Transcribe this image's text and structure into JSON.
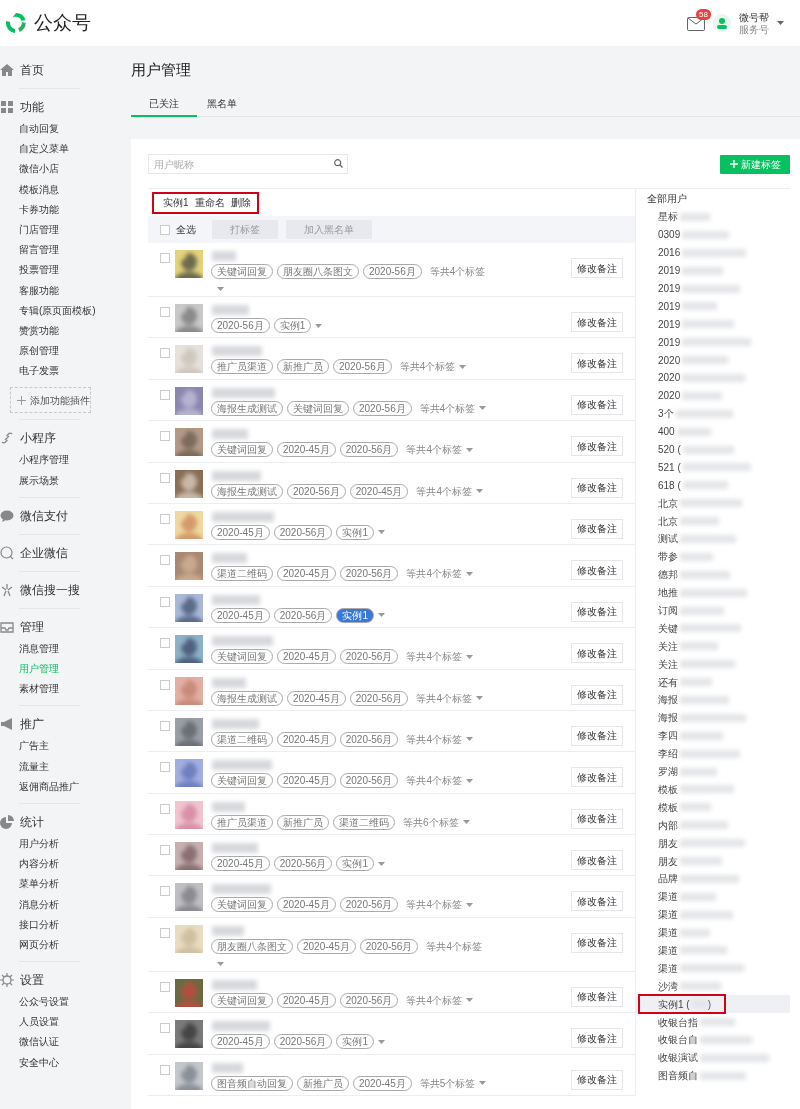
{
  "header": {
    "logo": "公众号",
    "mail_badge": "58",
    "account_name": "微号帮",
    "account_type": "服务号"
  },
  "sidebar": {
    "sections": [
      {
        "title": "首页"
      },
      {
        "title": "功能",
        "items": [
          {
            "label": "自动回复",
            "selected": false
          },
          {
            "label": "自定义菜单",
            "selected": false
          },
          {
            "label": "微信小店",
            "selected": false
          },
          {
            "label": "模板消息",
            "selected": false
          },
          {
            "label": "卡券功能",
            "selected": false
          },
          {
            "label": "门店管理",
            "selected": false
          },
          {
            "label": "留言管理",
            "selected": false
          },
          {
            "label": "投票管理",
            "selected": false
          },
          {
            "label": "客服功能",
            "selected": false
          },
          {
            "label": "专辑(原页面模板)",
            "selected": false
          },
          {
            "label": "赞赏功能",
            "selected": false
          },
          {
            "label": "原创管理",
            "selected": false
          },
          {
            "label": "电子发票",
            "selected": false
          }
        ],
        "add_button": "添加功能插件"
      },
      {
        "title": "小程序",
        "items": [
          {
            "label": "小程序管理",
            "selected": false
          },
          {
            "label": "展示场景",
            "selected": false
          }
        ]
      },
      {
        "title": "微信支付"
      },
      {
        "title": "企业微信"
      },
      {
        "title": "微信搜一搜"
      },
      {
        "title": "管理",
        "items": [
          {
            "label": "消息管理",
            "selected": false
          },
          {
            "label": "用户管理",
            "selected": true
          },
          {
            "label": "素材管理",
            "selected": false
          }
        ]
      },
      {
        "title": "推广",
        "items": [
          {
            "label": "广告主",
            "selected": false
          },
          {
            "label": "流量主",
            "selected": false
          },
          {
            "label": "返佣商品推广",
            "selected": false
          }
        ]
      },
      {
        "title": "统计",
        "items": [
          {
            "label": "用户分析",
            "selected": false
          },
          {
            "label": "内容分析",
            "selected": false
          },
          {
            "label": "菜单分析",
            "selected": false
          },
          {
            "label": "消息分析",
            "selected": false
          },
          {
            "label": "接口分析",
            "selected": false
          },
          {
            "label": "网页分析",
            "selected": false
          }
        ]
      },
      {
        "title": "设置",
        "items": [
          {
            "label": "公众号设置",
            "selected": false
          },
          {
            "label": "人员设置",
            "selected": false
          },
          {
            "label": "微信认证",
            "selected": false
          },
          {
            "label": "安全中心",
            "selected": false
          }
        ]
      }
    ]
  },
  "page_title": "用户管理",
  "tabs": [
    {
      "label": "已关注",
      "selected": true
    },
    {
      "label": "黑名单",
      "selected": false
    }
  ],
  "search": {
    "placeholder": "用户昵称"
  },
  "new_tag_button": "新建标签",
  "group_header": {
    "name": "实例1",
    "actions": [
      "重命名",
      "删除"
    ],
    "highlighted": true
  },
  "toolbar": {
    "select_all": {
      "label": "全选",
      "checked": false
    },
    "buttons": [
      {
        "label": "打标签",
        "disabled": true
      },
      {
        "label": "加入黑名单",
        "disabled": true
      }
    ]
  },
  "users": [
    {
      "checked": false,
      "tags": [
        {
          "label": "关键词回复",
          "selected": false
        },
        {
          "label": "朋友圈八条图文",
          "selected": false
        },
        {
          "label": "2020-56月",
          "selected": false
        }
      ],
      "more": "等共4个标签",
      "button": "修改备注"
    },
    {
      "checked": false,
      "tags": [
        {
          "label": "2020-56月",
          "selected": false
        },
        {
          "label": "实例1",
          "selected": false
        }
      ],
      "button": "修改备注"
    },
    {
      "checked": false,
      "tags": [
        {
          "label": "推广员渠道",
          "selected": false
        },
        {
          "label": "新推广员",
          "selected": false
        },
        {
          "label": "2020-56月",
          "selected": false
        }
      ],
      "more": "等共4个标签",
      "button": "修改备注"
    },
    {
      "checked": false,
      "tags": [
        {
          "label": "海报生成测试",
          "selected": false
        },
        {
          "label": "关键词回复",
          "selected": false
        },
        {
          "label": "2020-56月",
          "selected": false
        }
      ],
      "more": "等共4个标签",
      "button": "修改备注"
    },
    {
      "checked": false,
      "tags": [
        {
          "label": "关键词回复",
          "selected": false
        },
        {
          "label": "2020-45月",
          "selected": false
        },
        {
          "label": "2020-56月",
          "selected": false
        }
      ],
      "more": "等共4个标签",
      "button": "修改备注"
    },
    {
      "checked": false,
      "tags": [
        {
          "label": "海报生成测试",
          "selected": false
        },
        {
          "label": "2020-56月",
          "selected": false
        },
        {
          "label": "2020-45月",
          "selected": false
        }
      ],
      "more": "等共4个标签",
      "button": "修改备注"
    },
    {
      "checked": false,
      "tags": [
        {
          "label": "2020-45月",
          "selected": false
        },
        {
          "label": "2020-56月",
          "selected": false
        },
        {
          "label": "实例1",
          "selected": false
        }
      ],
      "button": "修改备注"
    },
    {
      "checked": false,
      "tags": [
        {
          "label": "渠道二维码",
          "selected": false
        },
        {
          "label": "2020-45月",
          "selected": false
        },
        {
          "label": "2020-56月",
          "selected": false
        }
      ],
      "more": "等共4个标签",
      "button": "修改备注"
    },
    {
      "checked": false,
      "tags": [
        {
          "label": "2020-45月",
          "selected": false
        },
        {
          "label": "2020-56月",
          "selected": false
        },
        {
          "label": "实例1",
          "selected": true
        }
      ],
      "button": "修改备注"
    },
    {
      "checked": false,
      "tags": [
        {
          "label": "关键词回复",
          "selected": false
        },
        {
          "label": "2020-45月",
          "selected": false
        },
        {
          "label": "2020-56月",
          "selected": false
        }
      ],
      "more": "等共4个标签",
      "button": "修改备注"
    },
    {
      "checked": false,
      "tags": [
        {
          "label": "海报生成测试",
          "selected": false
        },
        {
          "label": "2020-45月",
          "selected": false
        },
        {
          "label": "2020-56月",
          "selected": false
        }
      ],
      "more": "等共4个标签",
      "button": "修改备注"
    },
    {
      "checked": false,
      "tags": [
        {
          "label": "渠道二维码",
          "selected": false
        },
        {
          "label": "2020-45月",
          "selected": false
        },
        {
          "label": "2020-56月",
          "selected": false
        }
      ],
      "more": "等共4个标签",
      "button": "修改备注"
    },
    {
      "checked": false,
      "tags": [
        {
          "label": "关键词回复",
          "selected": false
        },
        {
          "label": "2020-45月",
          "selected": false
        },
        {
          "label": "2020-56月",
          "selected": false
        }
      ],
      "more": "等共4个标签",
      "button": "修改备注"
    },
    {
      "checked": false,
      "tags": [
        {
          "label": "推广员渠道",
          "selected": false
        },
        {
          "label": "新推广员",
          "selected": false
        },
        {
          "label": "渠道二维码",
          "selected": false
        }
      ],
      "more": "等共6个标签",
      "button": "修改备注"
    },
    {
      "checked": false,
      "tags": [
        {
          "label": "2020-45月",
          "selected": false
        },
        {
          "label": "2020-56月",
          "selected": false
        },
        {
          "label": "实例1",
          "selected": false
        }
      ],
      "button": "修改备注"
    },
    {
      "checked": false,
      "tags": [
        {
          "label": "关键词回复",
          "selected": false
        },
        {
          "label": "2020-45月",
          "selected": false
        },
        {
          "label": "2020-56月",
          "selected": false
        }
      ],
      "more": "等共4个标签",
      "button": "修改备注"
    },
    {
      "checked": false,
      "tags": [
        {
          "label": "朋友圈八条图文",
          "selected": false
        },
        {
          "label": "2020-45月",
          "selected": false
        },
        {
          "label": "2020-56月",
          "selected": false
        }
      ],
      "more": "等共4个标签",
      "button": "修改备注"
    },
    {
      "checked": false,
      "tags": [
        {
          "label": "关键词回复",
          "selected": false
        },
        {
          "label": "2020-45月",
          "selected": false
        },
        {
          "label": "2020-56月",
          "selected": false
        }
      ],
      "more": "等共4个标签",
      "button": "修改备注"
    },
    {
      "checked": false,
      "tags": [
        {
          "label": "2020-45月",
          "selected": false
        },
        {
          "label": "2020-56月",
          "selected": false
        },
        {
          "label": "实例1",
          "selected": false
        }
      ],
      "button": "修改备注"
    },
    {
      "checked": false,
      "tags": [
        {
          "label": "图音频自动回复",
          "selected": false
        },
        {
          "label": "新推广员",
          "selected": false
        },
        {
          "label": "2020-45月",
          "selected": false
        }
      ],
      "more": "等共5个标签",
      "button": "修改备注"
    }
  ],
  "tag_panel": {
    "title": "全部用户",
    "items": [
      {
        "label": "星标",
        "selected": false,
        "highlighted": false
      },
      {
        "label": "0309",
        "selected": false,
        "highlighted": false
      },
      {
        "label": "2016",
        "selected": false,
        "highlighted": false
      },
      {
        "label": "2019",
        "selected": false,
        "highlighted": false
      },
      {
        "label": "2019",
        "selected": false,
        "highlighted": false
      },
      {
        "label": "2019",
        "selected": false,
        "highlighted": false
      },
      {
        "label": "2019",
        "selected": false,
        "highlighted": false
      },
      {
        "label": "2019",
        "selected": false,
        "highlighted": false
      },
      {
        "label": "2020",
        "selected": false,
        "highlighted": false
      },
      {
        "label": "2020",
        "selected": false,
        "highlighted": false
      },
      {
        "label": "2020",
        "selected": false,
        "highlighted": false
      },
      {
        "label": "3个",
        "selected": false,
        "highlighted": false
      },
      {
        "label": "400",
        "selected": false,
        "highlighted": false
      },
      {
        "label": "520 (",
        "selected": false,
        "highlighted": false
      },
      {
        "label": "521 (",
        "selected": false,
        "highlighted": false
      },
      {
        "label": "618 (",
        "selected": false,
        "highlighted": false
      },
      {
        "label": "北京",
        "selected": false,
        "highlighted": false
      },
      {
        "label": "北京",
        "selected": false,
        "highlighted": false
      },
      {
        "label": "测试",
        "selected": false,
        "highlighted": false
      },
      {
        "label": "带参",
        "selected": false,
        "highlighted": false
      },
      {
        "label": "德邦",
        "selected": false,
        "highlighted": false
      },
      {
        "label": "地推",
        "selected": false,
        "highlighted": false
      },
      {
        "label": "订阅",
        "selected": false,
        "highlighted": false
      },
      {
        "label": "关键",
        "selected": false,
        "highlighted": false
      },
      {
        "label": "关注",
        "selected": false,
        "highlighted": false
      },
      {
        "label": "关注",
        "selected": false,
        "highlighted": false
      },
      {
        "label": "还有",
        "selected": false,
        "highlighted": false
      },
      {
        "label": "海报",
        "selected": false,
        "highlighted": false
      },
      {
        "label": "海报",
        "selected": false,
        "highlighted": false
      },
      {
        "label": "李四",
        "selected": false,
        "highlighted": false
      },
      {
        "label": "李绍",
        "selected": false,
        "highlighted": false
      },
      {
        "label": "罗湖",
        "selected": false,
        "highlighted": false
      },
      {
        "label": "模板",
        "selected": false,
        "highlighted": false
      },
      {
        "label": "模板",
        "selected": false,
        "highlighted": false
      },
      {
        "label": "内部",
        "selected": false,
        "highlighted": false
      },
      {
        "label": "朋友",
        "selected": false,
        "highlighted": false
      },
      {
        "label": "朋友",
        "selected": false,
        "highlighted": false
      },
      {
        "label": "品牌",
        "selected": false,
        "highlighted": false
      },
      {
        "label": "渠道",
        "selected": false,
        "highlighted": false
      },
      {
        "label": "渠道",
        "selected": false,
        "highlighted": false
      },
      {
        "label": "渠道",
        "selected": false,
        "highlighted": false
      },
      {
        "label": "渠道",
        "selected": false,
        "highlighted": false
      },
      {
        "label": "渠道",
        "selected": false,
        "highlighted": false
      },
      {
        "label": "沙湾",
        "selected": false,
        "highlighted": false
      },
      {
        "label": "实例1 (",
        "suffix": ")",
        "selected": true,
        "highlighted": true
      },
      {
        "label": "收银台指",
        "selected": false,
        "highlighted": false
      },
      {
        "label": "收银台自",
        "selected": false,
        "highlighted": false
      },
      {
        "label": "收银演试",
        "selected": false,
        "highlighted": false
      },
      {
        "label": "图音频自",
        "selected": false,
        "highlighted": false
      }
    ]
  }
}
